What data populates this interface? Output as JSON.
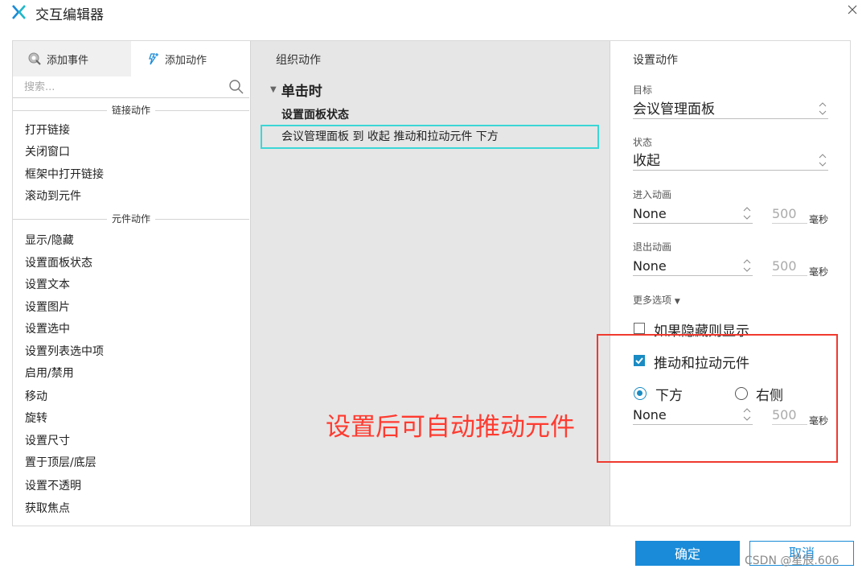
{
  "window": {
    "title": "交互编辑器"
  },
  "left_panel": {
    "tabs": [
      {
        "label": "添加事件"
      },
      {
        "label": "添加动作"
      }
    ],
    "search_placeholder": "搜索...",
    "groups": [
      {
        "header": "链接动作",
        "items": [
          "打开链接",
          "关闭窗口",
          "框架中打开链接",
          "滚动到元件"
        ]
      },
      {
        "header": "元件动作",
        "items": [
          "显示/隐藏",
          "设置面板状态",
          "设置文本",
          "设置图片",
          "设置选中",
          "设置列表选中项",
          "启用/禁用",
          "移动",
          "旋转",
          "设置尺寸",
          "置于顶层/底层",
          "设置不透明",
          "获取焦点"
        ]
      }
    ]
  },
  "middle_panel": {
    "title": "组织动作",
    "event": "单击时",
    "case_label": "设置面板状态",
    "action": "会议管理面板 到 收起 推动和拉动元件 下方"
  },
  "right_panel": {
    "title": "设置动作",
    "target_label": "目标",
    "target_value": "会议管理面板",
    "state_label": "状态",
    "state_value": "收起",
    "enter_anim_label": "进入动画",
    "enter_anim_value": "None",
    "enter_duration": "500",
    "exit_anim_label": "退出动画",
    "exit_anim_value": "None",
    "exit_duration": "500",
    "unit": "毫秒",
    "more_options": "更多选项",
    "show_if_hidden_label": "如果隐藏则显示",
    "push_pull_label": "推动和拉动元件",
    "radio_below": "下方",
    "radio_right": "右侧",
    "push_anim_value": "None",
    "push_duration": "500"
  },
  "annotation": {
    "text": "设置后可自动推动元件"
  },
  "buttons": {
    "ok": "确定",
    "cancel": "取消"
  },
  "watermark": "CSDN @星辰.606",
  "colors": {
    "accent": "#1a8bd8",
    "highlight_box": "#3cd6d6",
    "annotation_red": "#f03a2f"
  }
}
